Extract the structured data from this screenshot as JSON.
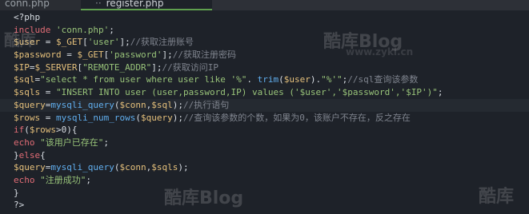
{
  "tabs": [
    {
      "label": "conn.php"
    },
    {
      "label": "register.php"
    }
  ],
  "code_lines": [
    [
      {
        "c": "pl",
        "t": "<?php"
      }
    ],
    [
      {
        "c": "kw",
        "t": "include"
      },
      {
        "c": "pl",
        "t": " "
      },
      {
        "c": "str",
        "t": "'conn.php'"
      },
      {
        "c": "pl",
        "t": ";"
      }
    ],
    [
      {
        "c": "var",
        "t": "$user"
      },
      {
        "c": "pl",
        "t": " = "
      },
      {
        "c": "var",
        "t": "$_GET"
      },
      {
        "c": "pl",
        "t": "["
      },
      {
        "c": "str",
        "t": "'user'"
      },
      {
        "c": "pl",
        "t": "];"
      },
      {
        "c": "cmt",
        "t": "//获取注册账号"
      }
    ],
    [
      {
        "c": "var",
        "t": "$password"
      },
      {
        "c": "pl",
        "t": " = "
      },
      {
        "c": "var",
        "t": "$_GET"
      },
      {
        "c": "pl",
        "t": "["
      },
      {
        "c": "str",
        "t": "'password'"
      },
      {
        "c": "pl",
        "t": "];"
      },
      {
        "c": "cmt",
        "t": "//获取注册密码"
      }
    ],
    [
      {
        "c": "var",
        "t": "$IP"
      },
      {
        "c": "pl",
        "t": "="
      },
      {
        "c": "var",
        "t": "$_SERVER"
      },
      {
        "c": "pl",
        "t": "["
      },
      {
        "c": "str",
        "t": "\"REMOTE_ADDR\""
      },
      {
        "c": "pl",
        "t": "];"
      },
      {
        "c": "cmt",
        "t": "//获取访问IP"
      }
    ],
    [
      {
        "c": "var",
        "t": "$sql"
      },
      {
        "c": "pl",
        "t": "="
      },
      {
        "c": "str",
        "t": "\"select * from user where user like '%\""
      },
      {
        "c": "pl",
        "t": ". "
      },
      {
        "c": "fn",
        "t": "trim"
      },
      {
        "c": "pl",
        "t": "("
      },
      {
        "c": "var",
        "t": "$user"
      },
      {
        "c": "pl",
        "t": ")."
      },
      {
        "c": "str",
        "t": "\"%'\""
      },
      {
        "c": "pl",
        "t": ";"
      },
      {
        "c": "cmt",
        "t": "//sql查询该参数"
      }
    ],
    [
      {
        "c": "var",
        "t": "$sqls"
      },
      {
        "c": "pl",
        "t": " = "
      },
      {
        "c": "str",
        "t": "\"INSERT INTO user (user,password,IP) values ('$user','$password','$IP')\""
      },
      {
        "c": "pl",
        "t": ";"
      }
    ],
    [
      {
        "c": "var",
        "t": "$query"
      },
      {
        "c": "pl",
        "t": "="
      },
      {
        "c": "fn",
        "t": "mysqli_query"
      },
      {
        "c": "pl",
        "t": "("
      },
      {
        "c": "var",
        "t": "$conn"
      },
      {
        "c": "pl",
        "t": ","
      },
      {
        "c": "var",
        "t": "$sql"
      },
      {
        "c": "pl",
        "t": ");"
      },
      {
        "c": "cmt",
        "t": "//执行语句"
      }
    ],
    [
      {
        "c": "var",
        "t": "$rows"
      },
      {
        "c": "pl",
        "t": " = "
      },
      {
        "c": "fn",
        "t": "mysqli_num_rows"
      },
      {
        "c": "pl",
        "t": "("
      },
      {
        "c": "var",
        "t": "$query"
      },
      {
        "c": "pl",
        "t": ");"
      },
      {
        "c": "cmt",
        "t": "//查询该参数的个数，如果为0，该账户不存在，反之存在"
      }
    ],
    [
      {
        "c": "kw",
        "t": "if"
      },
      {
        "c": "pl",
        "t": "("
      },
      {
        "c": "var",
        "t": "$rows"
      },
      {
        "c": "pl",
        "t": ">0){"
      }
    ],
    [
      {
        "c": "kw",
        "t": "echo"
      },
      {
        "c": "pl",
        "t": " "
      },
      {
        "c": "str",
        "t": "\"该用户已存在\""
      },
      {
        "c": "pl",
        "t": ";"
      }
    ],
    [
      {
        "c": "pl",
        "t": "}"
      },
      {
        "c": "kw",
        "t": "else"
      },
      {
        "c": "pl",
        "t": "{"
      }
    ],
    [
      {
        "c": "var",
        "t": "$query"
      },
      {
        "c": "pl",
        "t": "="
      },
      {
        "c": "fn",
        "t": "mysqli_query"
      },
      {
        "c": "pl",
        "t": "("
      },
      {
        "c": "var",
        "t": "$conn"
      },
      {
        "c": "pl",
        "t": ","
      },
      {
        "c": "var",
        "t": "$sqls"
      },
      {
        "c": "pl",
        "t": ");"
      }
    ],
    [
      {
        "c": "kw",
        "t": "echo"
      },
      {
        "c": "pl",
        "t": " "
      },
      {
        "c": "str",
        "t": "\"注册成功\""
      },
      {
        "c": "pl",
        "t": ";"
      }
    ],
    [
      {
        "c": "pl",
        "t": "}"
      }
    ],
    [
      {
        "c": "pl",
        "t": "?>"
      }
    ]
  ],
  "highlighted_line": 7,
  "watermarks": {
    "w1": "酷库Blog",
    "w2": "www.zyki.cn",
    "w3": "酷库",
    "w4": "酷库Blog",
    "w5": "酷库"
  },
  "colors": {
    "background": "#1e2229",
    "keyword": "#e06c75",
    "variable": "#e5c07b",
    "string": "#98c379",
    "function": "#61afef",
    "comment": "#7f848e",
    "active_tab_accent": "#5fa04e"
  }
}
